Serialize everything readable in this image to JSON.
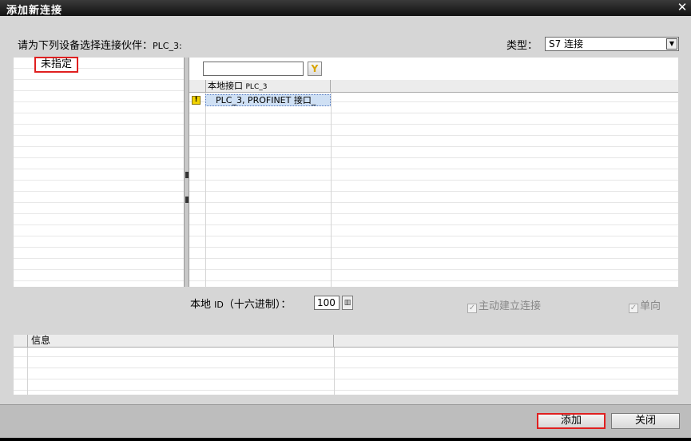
{
  "window": {
    "title": "添加新连接",
    "close_glyph": "✕"
  },
  "header": {
    "prompt_prefix": "请为下列设备选择连接伙伴：",
    "prompt_device": "PLC_3:",
    "type_label": "类型：",
    "type_value": "S7 连接"
  },
  "partner_tree": {
    "selected": "未指定"
  },
  "interface_table": {
    "filter_value": "",
    "column_header_prefix": "本地接口",
    "column_header_device": "PLC_3",
    "rows": [
      {
        "status": "warning",
        "status_glyph": "!",
        "label": "PLC_3, PROFINET 接口_"
      }
    ]
  },
  "local_id": {
    "label_prefix": "本地",
    "label_id": "ID",
    "label_suffix": "（十六进制）：",
    "value": "100"
  },
  "options": {
    "active_connect_label": "主动建立连接",
    "active_connect_checked": true,
    "oneway_label": "单向",
    "oneway_checked": true,
    "check_glyph": "✓"
  },
  "info": {
    "column_header": "信息"
  },
  "buttons": {
    "add_label": "添加",
    "close_label": "关闭"
  },
  "icons": {
    "filter": "filter-icon",
    "warning": "warning-icon",
    "browse": "browse-icon"
  },
  "colors": {
    "highlight": "#e02020",
    "selection": "#cfe0f4",
    "warning": "#f1d300"
  }
}
